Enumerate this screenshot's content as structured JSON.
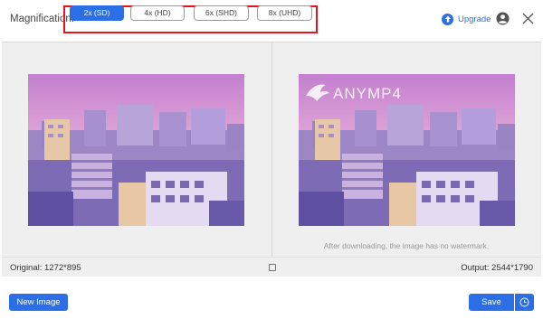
{
  "header": {
    "magnification_label": "Magnification:",
    "options": [
      {
        "label": "2x (SD)",
        "active": true
      },
      {
        "label": "4x (HD)",
        "active": false
      },
      {
        "label": "6x (SHD)",
        "active": false
      },
      {
        "label": "8x (UHD)",
        "active": false
      }
    ],
    "upgrade_label": "Upgrade"
  },
  "preview": {
    "watermark_text": "ANYMP4",
    "watermark_note": "After downloading, the image has no watermark."
  },
  "status": {
    "original": "Original: 1272*895",
    "output": "Output: 2544*1790"
  },
  "footer": {
    "new_image_label": "New Image",
    "save_label": "Save"
  },
  "colors": {
    "accent": "#2b6ee6",
    "highlight_border": "#e1161c"
  }
}
